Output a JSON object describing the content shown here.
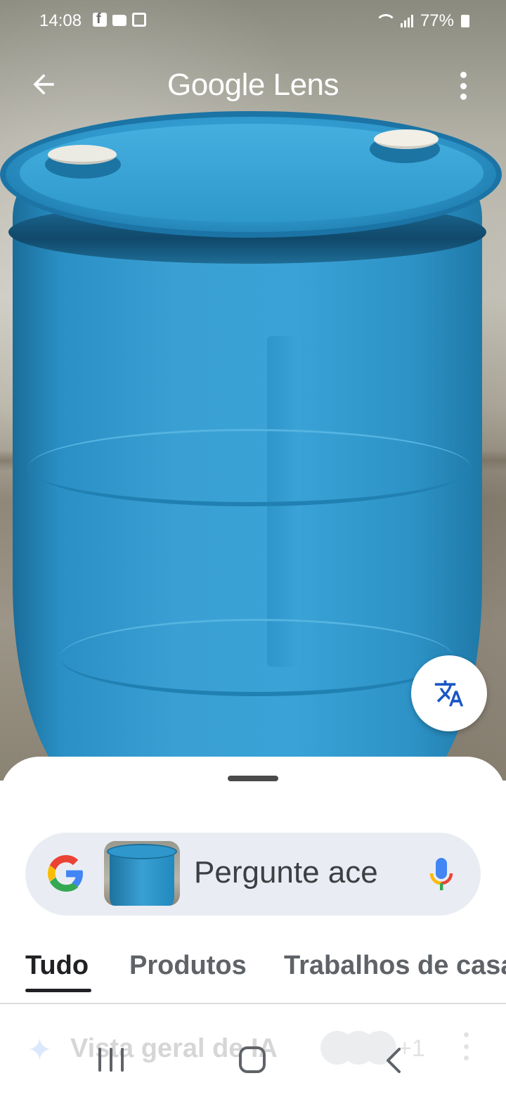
{
  "status_bar": {
    "time": "14:08",
    "battery": "77%",
    "notification_icons": [
      "facebook-icon",
      "folder-icon",
      "calendar-icon"
    ]
  },
  "header": {
    "title_brand": "Google",
    "title_product": "Lens",
    "back_icon": "arrow-left-icon",
    "more_icon": "more-vert-icon"
  },
  "translate_button": {
    "icon": "translate-icon"
  },
  "search": {
    "placeholder": "Pergunte ace",
    "logo_icon": "google-g-icon",
    "mic_icon": "mic-icon"
  },
  "tabs": [
    {
      "label": "Tudo",
      "active": true
    },
    {
      "label": "Produtos",
      "active": false
    },
    {
      "label": "Trabalhos de casa",
      "active": false
    }
  ],
  "ai_overview": {
    "label": "Vista geral de IA",
    "extra_count": "+1"
  },
  "nav": {
    "recent_icon": "recent-apps-icon",
    "home_icon": "home-icon",
    "back_icon": "back-icon"
  },
  "colors": {
    "accent_blue": "#1a73e8",
    "barrel_blue": "#3aa0d4",
    "search_bg": "#e9edf3"
  }
}
